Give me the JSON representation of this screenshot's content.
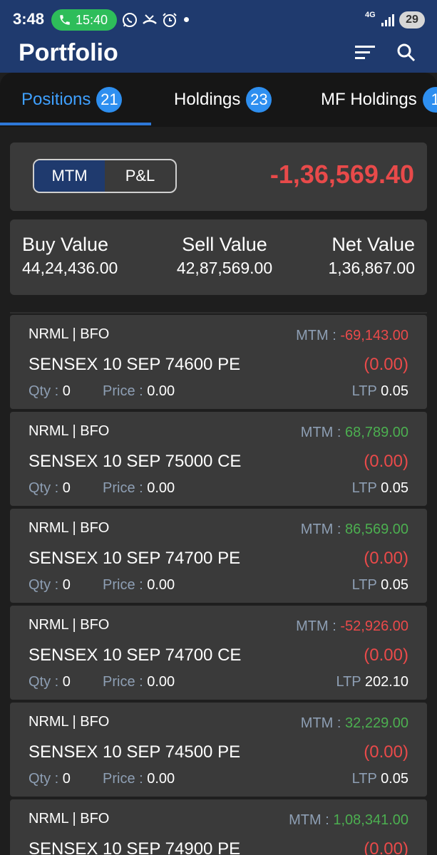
{
  "status_bar": {
    "time": "3:48",
    "call_timer": "15:40",
    "network": "4G",
    "battery": "29",
    "icons": [
      "phone-icon",
      "whatsapp-icon",
      "missed-call-icon",
      "alarm-icon",
      "signal-icon"
    ]
  },
  "header": {
    "title": "Portfolio",
    "filter_icon": "filter-icon",
    "search_icon": "search-icon"
  },
  "tabs": [
    {
      "label": "Positions",
      "count": "21",
      "active": true
    },
    {
      "label": "Holdings",
      "count": "23",
      "active": false
    },
    {
      "label": "MF Holdings",
      "count": "1",
      "active": false
    }
  ],
  "toggle": {
    "mtm_label": "MTM",
    "pnl_label": "P&L",
    "selected": "MTM"
  },
  "total_mtm": "-1,36,569.40",
  "summary": {
    "buy_label": "Buy Value",
    "buy_value": "44,24,436.00",
    "sell_label": "Sell Value",
    "sell_value": "42,87,569.00",
    "net_label": "Net Value",
    "net_value": "1,36,867.00"
  },
  "labels": {
    "mtm": "MTM : ",
    "qty": "Qty : ",
    "price": "Price : ",
    "ltp": "LTP "
  },
  "positions": [
    {
      "type": "NRML | BFO",
      "symbol": "SENSEX 10 SEP 74600 PE",
      "mtm": "-69,143.00",
      "change": "(0.00)",
      "qty": "0",
      "price": "0.00",
      "ltp": "0.05"
    },
    {
      "type": "NRML | BFO",
      "symbol": "SENSEX 10 SEP 75000 CE",
      "mtm": "68,789.00",
      "change": "(0.00)",
      "qty": "0",
      "price": "0.00",
      "ltp": "0.05"
    },
    {
      "type": "NRML | BFO",
      "symbol": "SENSEX 10 SEP 74700 PE",
      "mtm": "86,569.00",
      "change": "(0.00)",
      "qty": "0",
      "price": "0.00",
      "ltp": "0.05"
    },
    {
      "type": "NRML | BFO",
      "symbol": "SENSEX 10 SEP 74700 CE",
      "mtm": "-52,926.00",
      "change": "(0.00)",
      "qty": "0",
      "price": "0.00",
      "ltp": "202.10"
    },
    {
      "type": "NRML | BFO",
      "symbol": "SENSEX 10 SEP 74500 PE",
      "mtm": "32,229.00",
      "change": "(0.00)",
      "qty": "0",
      "price": "0.00",
      "ltp": "0.05"
    },
    {
      "type": "NRML | BFO",
      "symbol": "SENSEX 10 SEP 74900 PE",
      "mtm": "1,08,341.00",
      "change": "(0.00)",
      "qty": "",
      "price": "",
      "ltp": ""
    }
  ],
  "colors": {
    "header_bg": "#1f3a6e",
    "accent_blue": "#2e8ff0",
    "loss_red": "#ea4a4a",
    "profit_green": "#4caf50",
    "card_bg": "#3a3a3a"
  }
}
